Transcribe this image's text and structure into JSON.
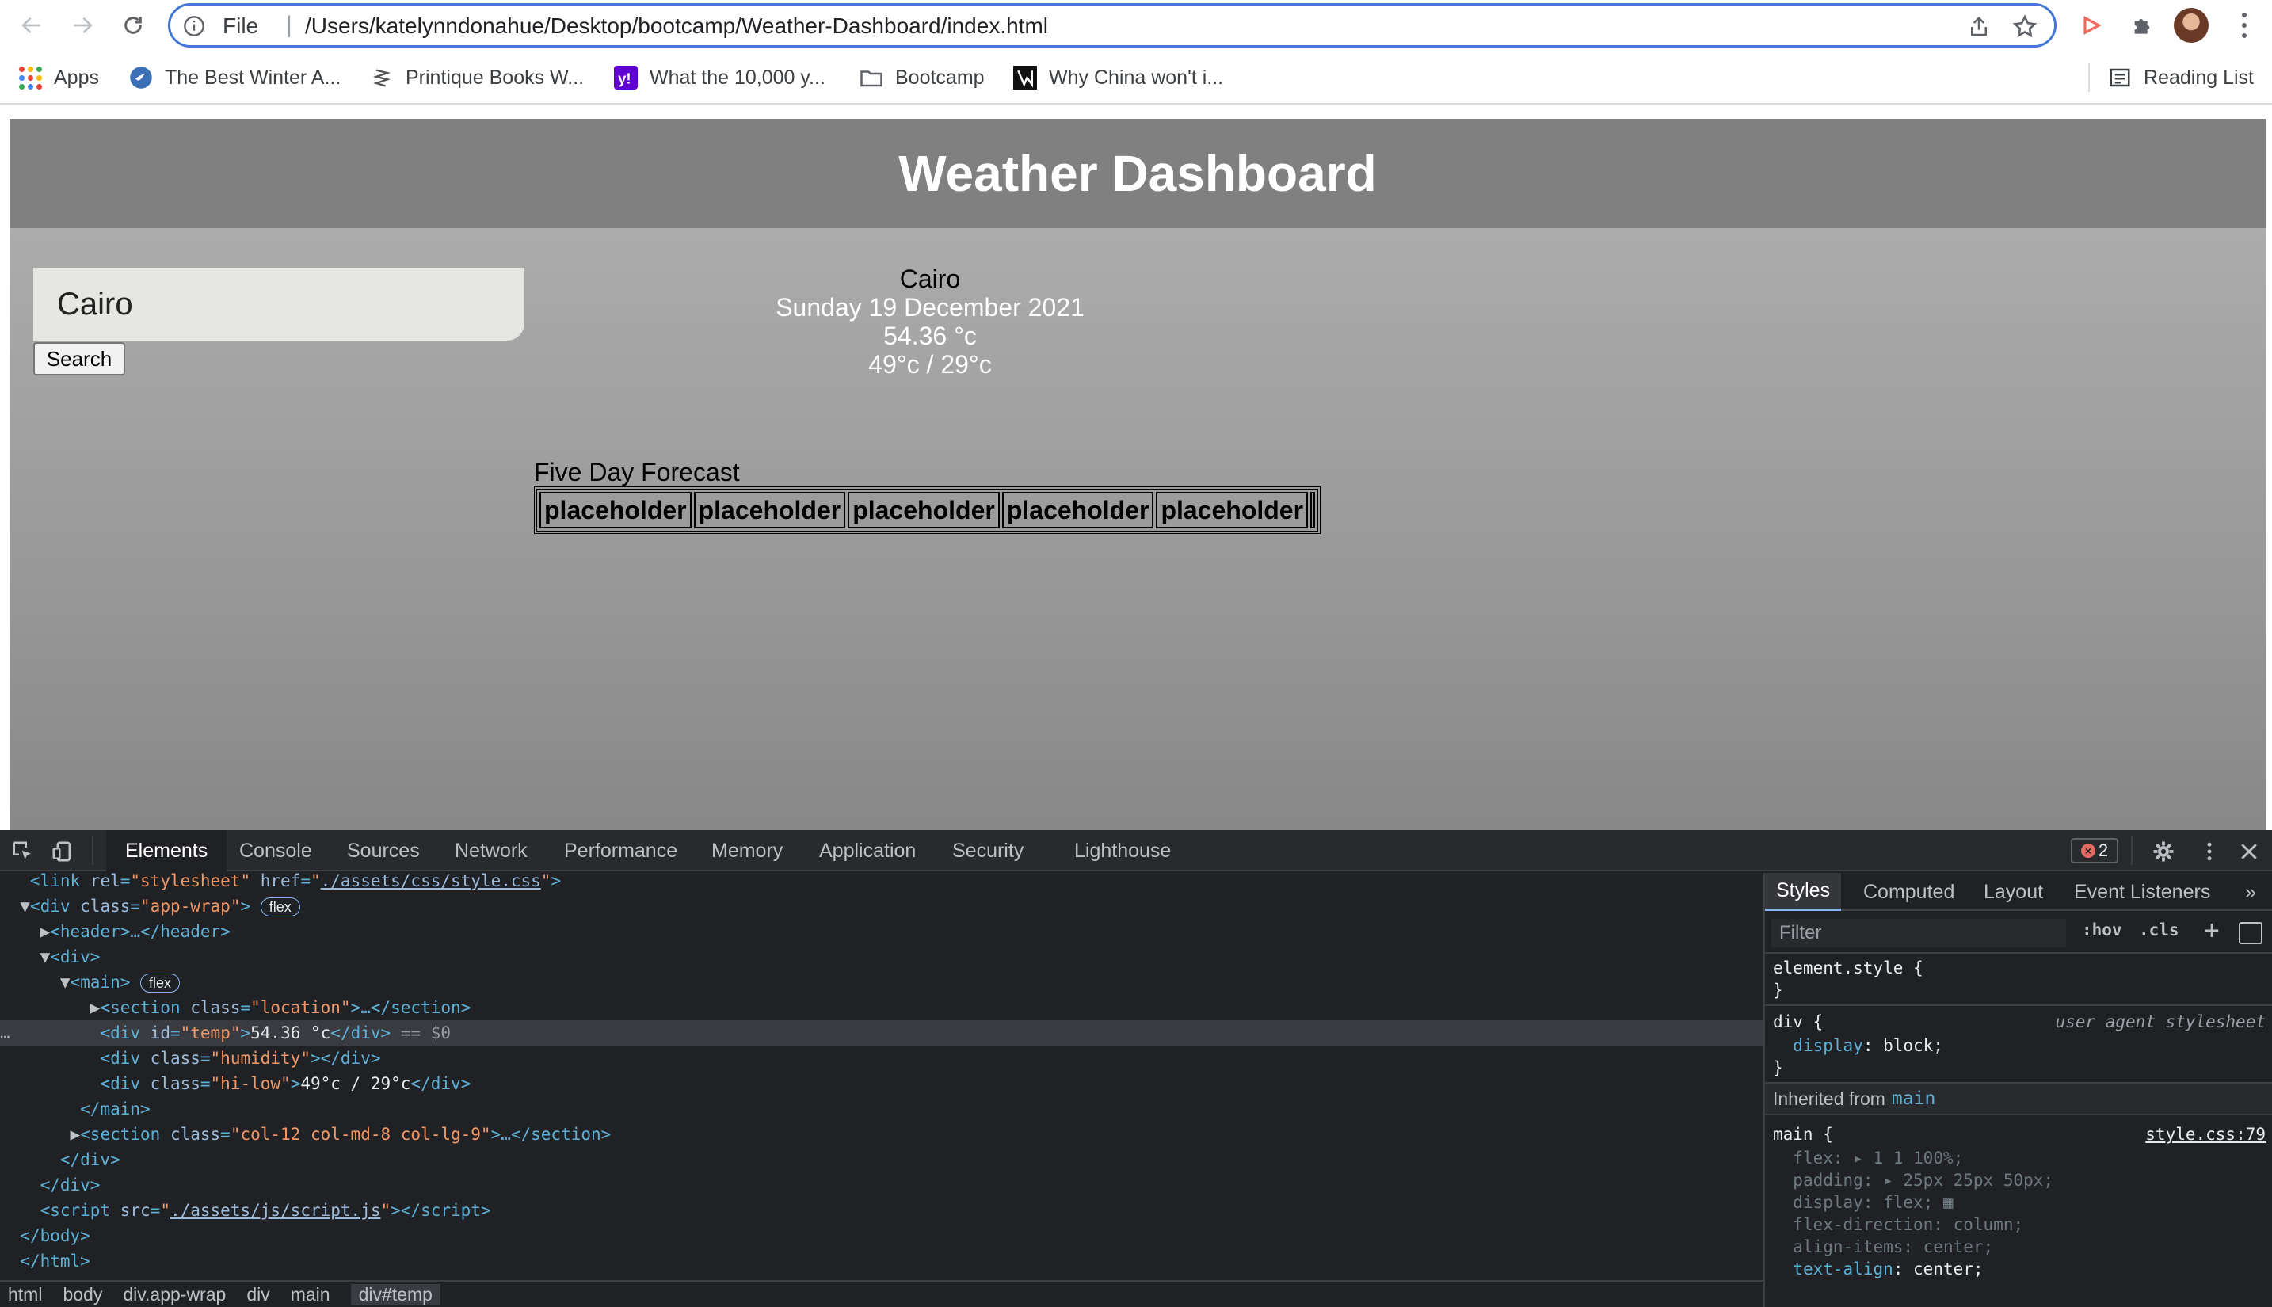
{
  "browser": {
    "omnibox": {
      "scheme": "File",
      "url": "/Users/katelynndonahue/Desktop/bootcamp/Weather-Dashboard/index.html"
    },
    "bookmarks": [
      {
        "label": "Apps",
        "icon": "apps-grid-icon"
      },
      {
        "label": "The Best Winter A...",
        "icon": "bird-icon"
      },
      {
        "label": "Printique Books W...",
        "icon": "printique-icon"
      },
      {
        "label": "What the 10,000 y...",
        "icon": "yahoo-icon"
      },
      {
        "label": "Bootcamp",
        "icon": "folder-icon"
      },
      {
        "label": "Why China won't i...",
        "icon": "article-icon"
      }
    ],
    "reading_list": "Reading List"
  },
  "app": {
    "title": "Weather Dashboard",
    "search": {
      "value": "Cairo",
      "button_label": "Search"
    },
    "current": {
      "city": "Cairo",
      "date": "Sunday 19 December 2021",
      "temp": "54.36 °c",
      "hi_low": "49°c / 29°c"
    },
    "forecast": {
      "label": "Five Day Forecast",
      "cells": [
        "placeholder",
        "placeholder",
        "placeholder",
        "placeholder",
        "placeholder"
      ]
    }
  },
  "devtools": {
    "tabs": [
      "Elements",
      "Console",
      "Sources",
      "Network",
      "Performance",
      "Memory",
      "Application",
      "Security",
      "Lighthouse"
    ],
    "active_tab": "Elements",
    "error_count": "2",
    "dom": [
      {
        "indent": "   ",
        "tri": "",
        "open": "<link ",
        "a1": "rel",
        "v1": "\"stylesheet\"",
        "a2": "href",
        "v2": "\"./assets/css/style.css\"",
        "close": ">"
      },
      {
        "pill": "flex"
      },
      {
        "pill": "flex"
      }
    ],
    "dom_text": {
      "line2_attr": "class",
      "line2_val": "\"app-wrap\"",
      "header": "<header>…</header>",
      "div_open": "<div>",
      "main_open": "<main>",
      "section_location_val": "\"location\"",
      "temp_id_val": "\"temp\"",
      "temp_text": "54.36 °c",
      "selected_marker": "== $0",
      "humidity_val": "\"humidity\"",
      "hilow_val": "\"hi-low\"",
      "hilow_text": "49°c / 29°c",
      "main_close": "</main>",
      "section_cols_val": "\"col-12 col-md-8 col-lg-9\"",
      "div_close": "</div>",
      "script_src": "./assets/js/script.js",
      "body_close": "</body>",
      "html_close": "</html>"
    },
    "breadcrumbs": [
      "html",
      "body",
      "div.app-wrap",
      "div",
      "main",
      "div#temp"
    ],
    "styles_panel": {
      "tabs": [
        "Styles",
        "Computed",
        "Layout",
        "Event Listeners"
      ],
      "filter_placeholder": "Filter",
      "hov": ":hov",
      "cls": ".cls",
      "element_style": "element.style {",
      "close_brace": "}",
      "div_selector": "div {",
      "ua_label": "user agent stylesheet",
      "div_display": "display",
      "div_display_val": "block;",
      "inherited_label": "Inherited from",
      "inherited_from": "main",
      "main_selector": "main {",
      "main_source": "style.css:79",
      "main_props": [
        {
          "name": "flex",
          "value": "▸ 1 1 100%;",
          "faded": true
        },
        {
          "name": "padding",
          "value": "▸ 25px 25px 50px;",
          "faded": true
        },
        {
          "name": "display",
          "value": "flex; ▦",
          "faded": true
        },
        {
          "name": "flex-direction",
          "value": "column;",
          "faded": true
        },
        {
          "name": "align-items",
          "value": "center;",
          "faded": true
        },
        {
          "name": "text-align",
          "value": "center;",
          "faded": false
        }
      ]
    }
  }
}
